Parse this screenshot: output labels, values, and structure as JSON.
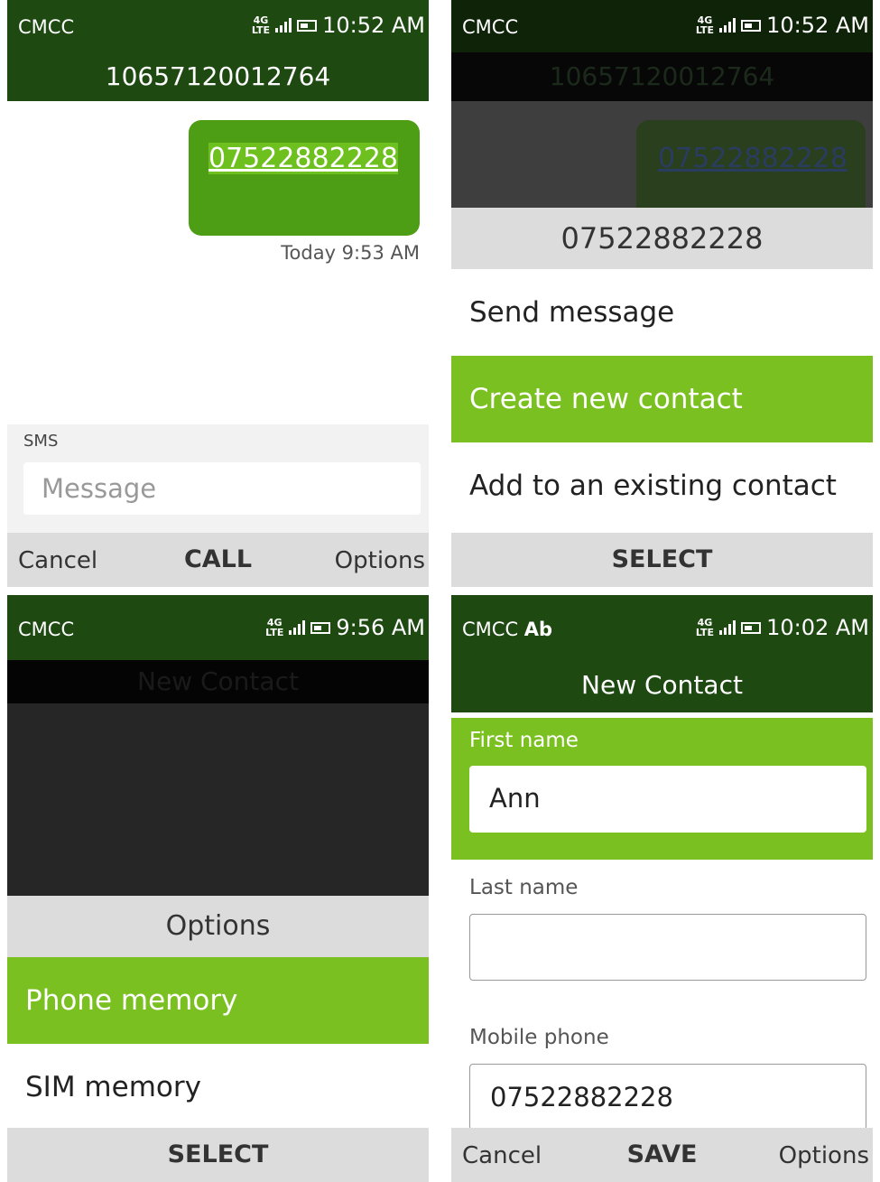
{
  "panels": [
    {
      "status": {
        "carrier": "CMCC",
        "network": "4G LTE",
        "time": "10:52 AM"
      },
      "title": "10657120012764",
      "message": {
        "text": "07522882228",
        "timestamp": "Today 9:53 AM"
      },
      "compose": {
        "label": "SMS",
        "placeholder": "Message"
      },
      "softkeys": {
        "left": "Cancel",
        "center": "CALL",
        "right": "Options"
      }
    },
    {
      "status": {
        "carrier": "CMCC",
        "network": "4G LTE",
        "time": "10:52 AM"
      },
      "title": "10657120012764",
      "bubble_text": "07522882228",
      "menu_header": "07522882228",
      "menu_items": [
        "Send message",
        "Create new contact",
        "Add to an existing contact"
      ],
      "selected_item": "Create new contact",
      "softkeys": {
        "center": "SELECT"
      }
    },
    {
      "status": {
        "carrier": "CMCC",
        "network": "4G LTE",
        "time": "9:56 AM"
      },
      "title": "New Contact",
      "menu_header": "Options",
      "menu_items": [
        "Phone memory",
        "SIM memory"
      ],
      "selected_item": "Phone memory",
      "softkeys": {
        "center": "SELECT"
      }
    },
    {
      "status": {
        "carrier": "CMCC",
        "input_mode": "Ab",
        "network": "4G LTE",
        "time": "10:02 AM"
      },
      "title": "New Contact",
      "fields": [
        {
          "label": "First name",
          "value": "Ann"
        },
        {
          "label": "Last name",
          "value": ""
        },
        {
          "label": "Mobile phone",
          "value": "07522882228"
        }
      ],
      "softkeys": {
        "left": "Cancel",
        "center": "SAVE",
        "right": "Options"
      }
    }
  ],
  "colors": {
    "header_green": "#1e4a12",
    "accent_green": "#7ac020",
    "bubble_green": "#4d9d15"
  }
}
